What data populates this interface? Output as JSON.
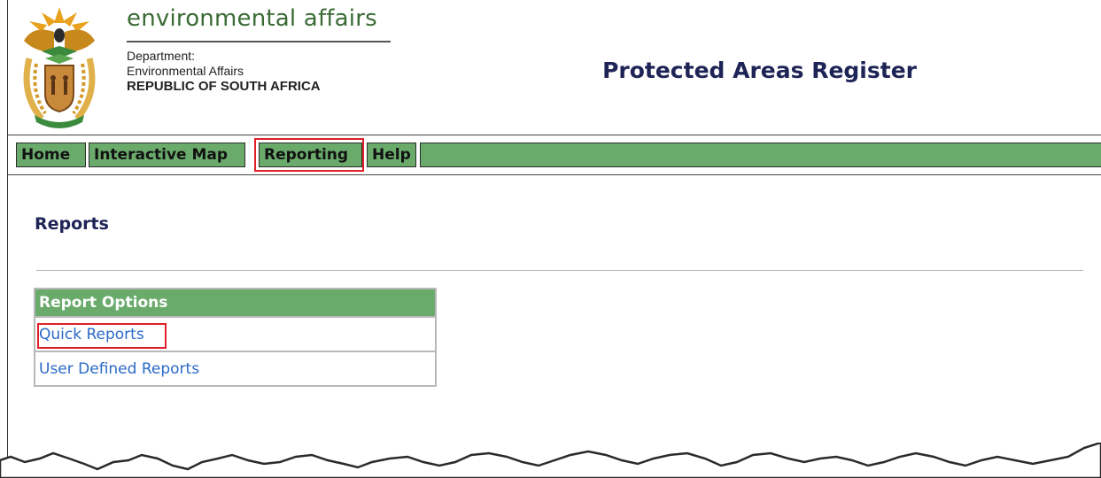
{
  "header": {
    "brand_title": "environmental affairs",
    "department_label": "Department:",
    "department_name": "Environmental Affairs",
    "country": "REPUBLIC OF SOUTH AFRICA",
    "site_title": "Protected Areas Register",
    "crest_icon": "coat-of-arms-icon"
  },
  "nav": {
    "items": [
      {
        "label": "Home"
      },
      {
        "label": "Interactive Map"
      },
      {
        "label": "Reporting"
      },
      {
        "label": "Help"
      }
    ],
    "active_item": "Reporting",
    "bar_color": "#6aab6c",
    "highlight_color": "#e0202a"
  },
  "content": {
    "heading": "Reports",
    "options_panel": {
      "header": "Report Options",
      "items": [
        {
          "label": "Quick Reports",
          "highlighted": true
        },
        {
          "label": "User Defined Reports",
          "highlighted": false
        }
      ]
    }
  },
  "colors": {
    "title_navy": "#1f2456",
    "brand_green": "#3a6b35",
    "link_blue": "#2a6ac8"
  }
}
